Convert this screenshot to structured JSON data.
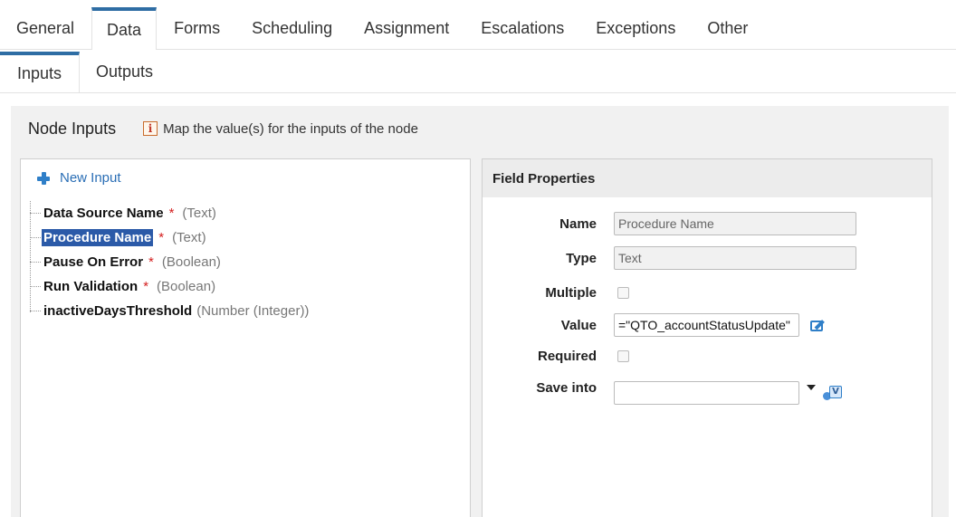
{
  "tabs": [
    "General",
    "Data",
    "Forms",
    "Scheduling",
    "Assignment",
    "Escalations",
    "Exceptions",
    "Other"
  ],
  "active_tab": "Data",
  "subtabs": [
    "Inputs",
    "Outputs"
  ],
  "active_subtab": "Inputs",
  "panel": {
    "title": "Node Inputs",
    "info_icon_glyph": "i",
    "hint": "Map the value(s) for the inputs of the node"
  },
  "tree": {
    "new_input_label": "New Input",
    "items": [
      {
        "name": "Data Source Name",
        "required_mark": "*",
        "type": "(Text)"
      },
      {
        "name": "Procedure Name",
        "required_mark": "*",
        "type": "(Text)"
      },
      {
        "name": "Pause On Error",
        "required_mark": "*",
        "type": "(Boolean)"
      },
      {
        "name": "Run Validation",
        "required_mark": "*",
        "type": "(Boolean)"
      },
      {
        "name": "inactiveDaysThreshold",
        "required_mark": "",
        "type": "(Number (Integer))"
      }
    ],
    "selected": "Procedure Name"
  },
  "props": {
    "header": "Field Properties",
    "name_label": "Name",
    "name_value": "Procedure Name",
    "type_label": "Type",
    "type_value": "Text",
    "multiple_label": "Multiple",
    "value_label": "Value",
    "value_value": "=\"QTO_accountStatusUpdate\"",
    "required_label": "Required",
    "save_into_label": "Save into",
    "save_into_value": "",
    "var_icon_glyph": "V"
  },
  "colors": {
    "accent": "#2e6da4",
    "selection": "#2b5aa8",
    "required": "#d42020",
    "link": "#2a6eb5"
  }
}
